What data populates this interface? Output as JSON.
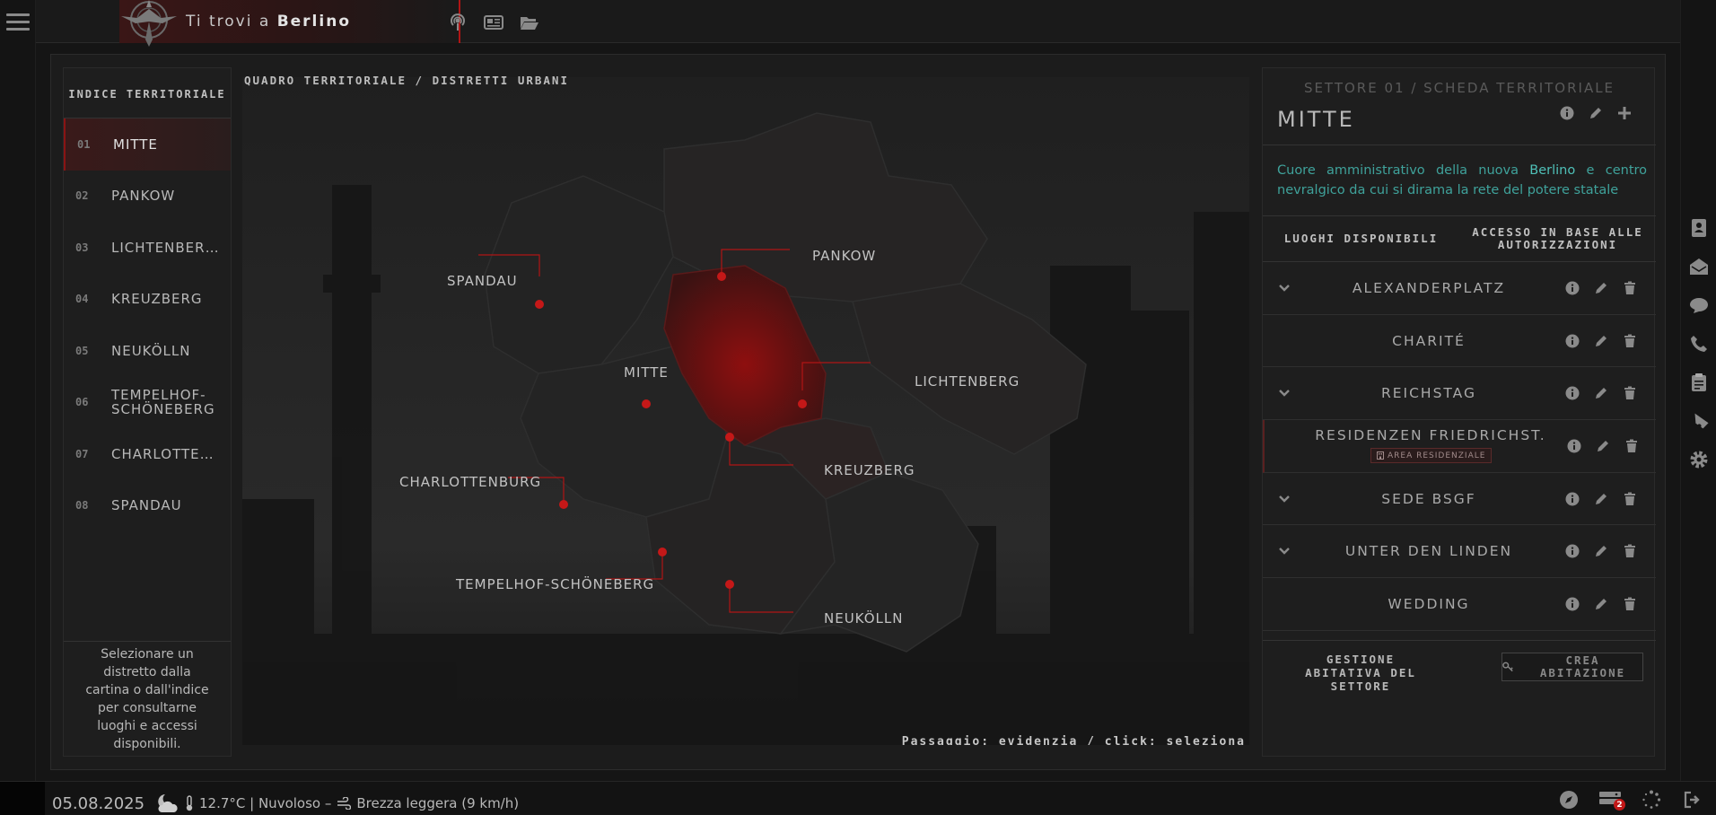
{
  "header": {
    "brand_prefix": "Ti trovi a",
    "brand_city": "Berlino",
    "icons": [
      "podcast-icon",
      "newspaper-icon",
      "folder-open-icon"
    ]
  },
  "left_sidebar": {
    "menu_icon": "hamburger-icon"
  },
  "index": {
    "title": "INDICE TERRITORIALE",
    "items": [
      {
        "num": "01",
        "label": "MITTE",
        "active": true
      },
      {
        "num": "02",
        "label": "PANKOW"
      },
      {
        "num": "03",
        "label": "LICHTENBER…"
      },
      {
        "num": "04",
        "label": "KREUZBERG"
      },
      {
        "num": "05",
        "label": "NEUKÖLLN"
      },
      {
        "num": "06",
        "label": "TEMPELHOF-SCHÖNEBERG"
      },
      {
        "num": "07",
        "label": "CHARLOTTE…"
      },
      {
        "num": "08",
        "label": "SPANDAU"
      }
    ],
    "hint": "Selezionare un distretto dalla cartina o dall'indice per consultarne luoghi e accessi disponibili."
  },
  "map": {
    "title": "QUADRO TERRITORIALE / DISTRETTI URBANI",
    "hint": "Passaggio: evidenzia / click: seleziona",
    "districts": {
      "spandau": "SPANDAU",
      "pankow": "PANKOW",
      "mitte": "MITTE",
      "lichtenberg": "LICHTENBERG",
      "kreuzberg": "KREUZBERG",
      "charlottenburg": "CHARLOTTENBURG",
      "tempelhof": "TEMPELHOF-SCHÖNEBERG",
      "neukolln": "NEUKÖLLN"
    },
    "accent": "#b01515"
  },
  "sector": {
    "subtitle": "SETTORE 01 / SCHEDA TERRITORIALE",
    "title": "MITTE",
    "desc_pre": "Cuore amministrativo della nuova",
    "desc_city": "Berlino",
    "desc_post": "e centro nevralgico da cui si dirama la rete del potere statale",
    "tab_places": "LUOGHI DISPONIBILI",
    "tab_access": "ACCESSO IN BASE ALLE AUTORIZZAZIONI",
    "places": [
      {
        "name": "ALEXANDERPLATZ",
        "expandable": true
      },
      {
        "name": "CHARITÉ",
        "expandable": false
      },
      {
        "name": "REICHSTAG",
        "expandable": true
      },
      {
        "name": "RESIDENZEN FRIEDRICHST.",
        "expandable": false,
        "badge": "AREA RESIDENZIALE"
      },
      {
        "name": "SEDE BSGF",
        "expandable": true
      },
      {
        "name": "UNTER DEN LINDEN",
        "expandable": true
      },
      {
        "name": "WEDDING",
        "expandable": false
      }
    ],
    "footer_label": "GESTIONE ABITATIVA DEL SETTORE",
    "create_label": "CREA ABITAZIONE"
  },
  "status": {
    "date": "05.08.2025",
    "weather": "12.7°C | Nuvoloso – ",
    "wind": "Brezza leggera (9 km/h)",
    "notif_count": "2"
  }
}
